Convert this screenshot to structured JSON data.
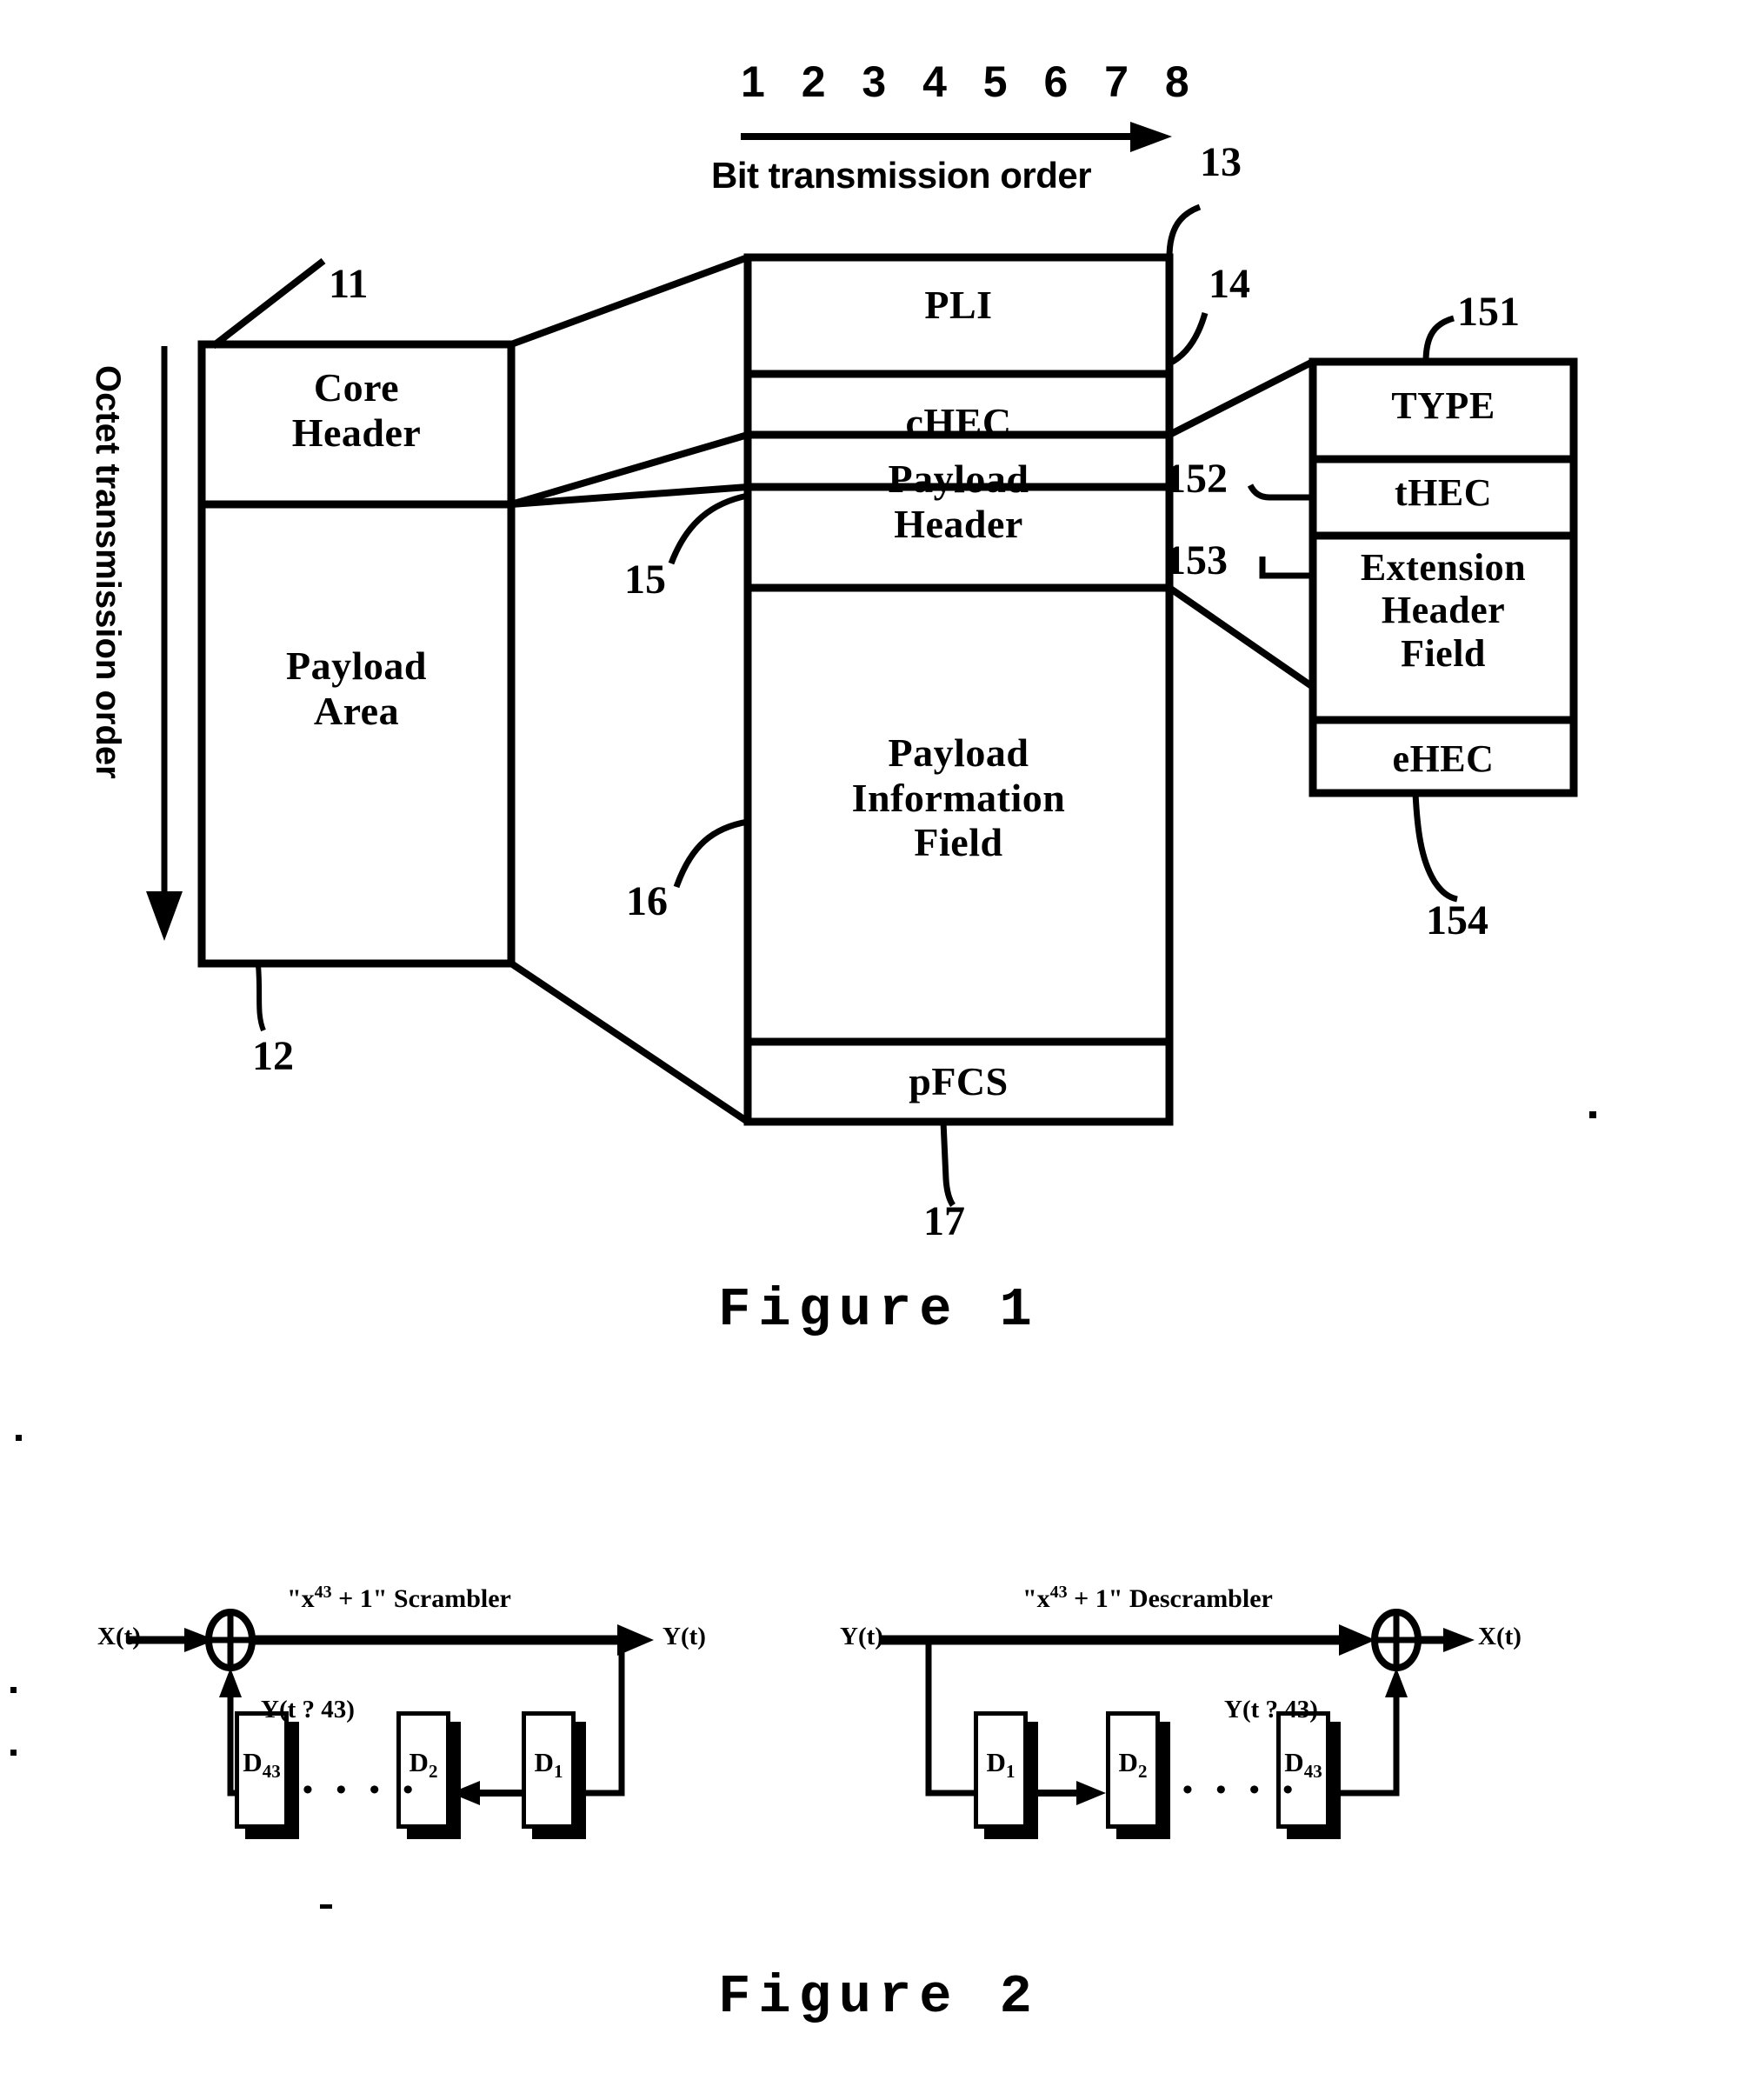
{
  "figure1": {
    "caption": "Figure 1",
    "bit_scale_numbers": "1 2 3 4 5 6 7 8",
    "bit_order_label": "Bit transmission order",
    "octet_order_label": "Octet transmission order",
    "blocks": {
      "core_header": "Core\nHeader",
      "payload_area": "Payload\nArea",
      "pli": "PLI",
      "chec": "cHEC",
      "payload_header": "Payload\nHeader",
      "payload_information_field": "Payload\nInformation\nField",
      "pfcs": "pFCS",
      "type": "TYPE",
      "thec": "tHEC",
      "extension_header_field": "Extension\nHeader\nField",
      "ehec": "eHEC"
    },
    "reference_numerals": {
      "core_header": "11",
      "payload_area": "12",
      "core_header_detail": "13",
      "chec": "14",
      "payload_header": "15",
      "payload_information_field": "16",
      "pfcs": "17",
      "type": "151",
      "thec": "152",
      "extension_header_field": "153",
      "ehec": "154"
    }
  },
  "figure2": {
    "caption": "Figure 2",
    "scrambler": {
      "title_prefix": "\"x",
      "title_exponent": "43",
      "title_suffix": " + 1\" Scrambler",
      "input_label": "X(t)",
      "output_label": "Y(t)",
      "feedback_label": "Y(t ? 43)",
      "registers": [
        {
          "name": "D",
          "index": "43"
        },
        {
          "name": "D",
          "index": "2"
        },
        {
          "name": "D",
          "index": "1"
        }
      ],
      "ellipsis": "• • • •"
    },
    "descrambler": {
      "title_prefix": "\"x",
      "title_exponent": "43",
      "title_suffix": " + 1\" Descrambler",
      "input_label": "Y(t)",
      "output_label": "X(t)",
      "feedback_label": "Y(t ? 43)",
      "registers": [
        {
          "name": "D",
          "index": "1"
        },
        {
          "name": "D",
          "index": "2"
        },
        {
          "name": "D",
          "index": "43"
        }
      ],
      "ellipsis": "• • • •"
    }
  },
  "colors": {
    "ink": "#000000",
    "paper": "#ffffff"
  }
}
